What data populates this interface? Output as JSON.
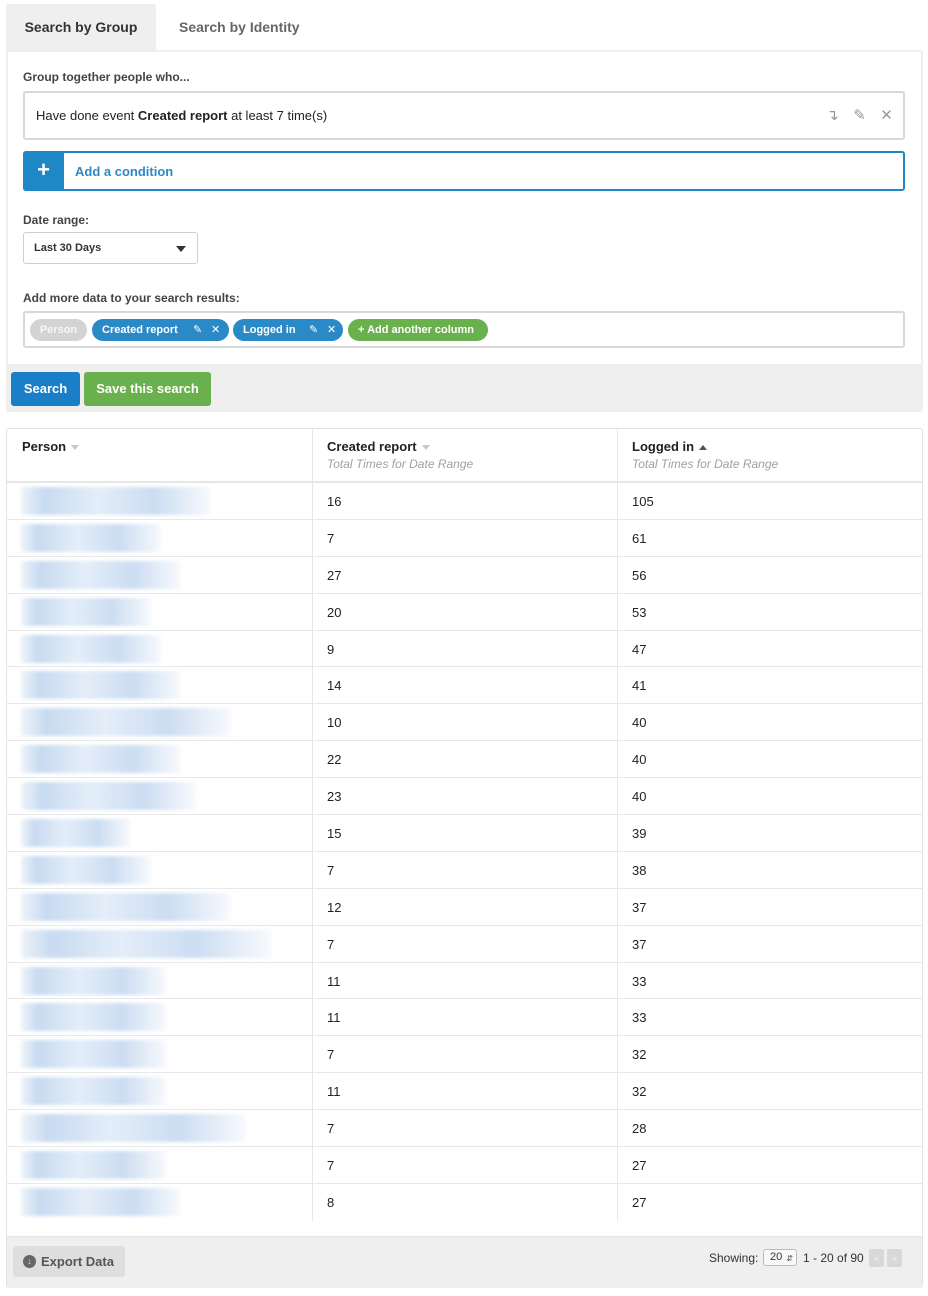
{
  "tabs": [
    {
      "label": "Search by Group",
      "active": true
    },
    {
      "label": "Search by Identity",
      "active": false
    }
  ],
  "group_label": "Group together people who...",
  "condition": {
    "prefix": "Have done event ",
    "event": "Created report",
    "suffix": " at least 7 time(s)",
    "icons": [
      "move-down-icon",
      "pencil-icon",
      "close-icon"
    ]
  },
  "add_condition": {
    "icon": "+",
    "label": "Add a condition"
  },
  "date_range": {
    "label": "Date range:",
    "value": "Last 30 Days"
  },
  "columns": {
    "label": "Add more data to your search results:",
    "pills": [
      "Person",
      "Created report",
      "Logged in"
    ],
    "add_label": "+ Add another column"
  },
  "buttons": {
    "search": "Search",
    "save": "Save this search"
  },
  "table": {
    "headers": [
      {
        "title": "Person",
        "subtitle": ""
      },
      {
        "title": "Created report",
        "subtitle": "Total Times for Date Range"
      },
      {
        "title": "Logged in",
        "subtitle": "Total Times for Date Range"
      }
    ],
    "rows": [
      {
        "created": "16",
        "logged": "105"
      },
      {
        "created": "7",
        "logged": "61"
      },
      {
        "created": "27",
        "logged": "56"
      },
      {
        "created": "20",
        "logged": "53"
      },
      {
        "created": "9",
        "logged": "47"
      },
      {
        "created": "14",
        "logged": "41"
      },
      {
        "created": "10",
        "logged": "40"
      },
      {
        "created": "22",
        "logged": "40"
      },
      {
        "created": "23",
        "logged": "40"
      },
      {
        "created": "15",
        "logged": "39"
      },
      {
        "created": "7",
        "logged": "38"
      },
      {
        "created": "12",
        "logged": "37"
      },
      {
        "created": "7",
        "logged": "37"
      },
      {
        "created": "11",
        "logged": "33"
      },
      {
        "created": "11",
        "logged": "33"
      },
      {
        "created": "7",
        "logged": "32"
      },
      {
        "created": "11",
        "logged": "32"
      },
      {
        "created": "7",
        "logged": "28"
      },
      {
        "created": "7",
        "logged": "27"
      },
      {
        "created": "8",
        "logged": "27"
      }
    ]
  },
  "footer": {
    "export_label": "Export Data",
    "showing_label": "Showing:",
    "page_size": "20",
    "range": "1 - 20 of 90",
    "prev": "«",
    "next": "»"
  }
}
